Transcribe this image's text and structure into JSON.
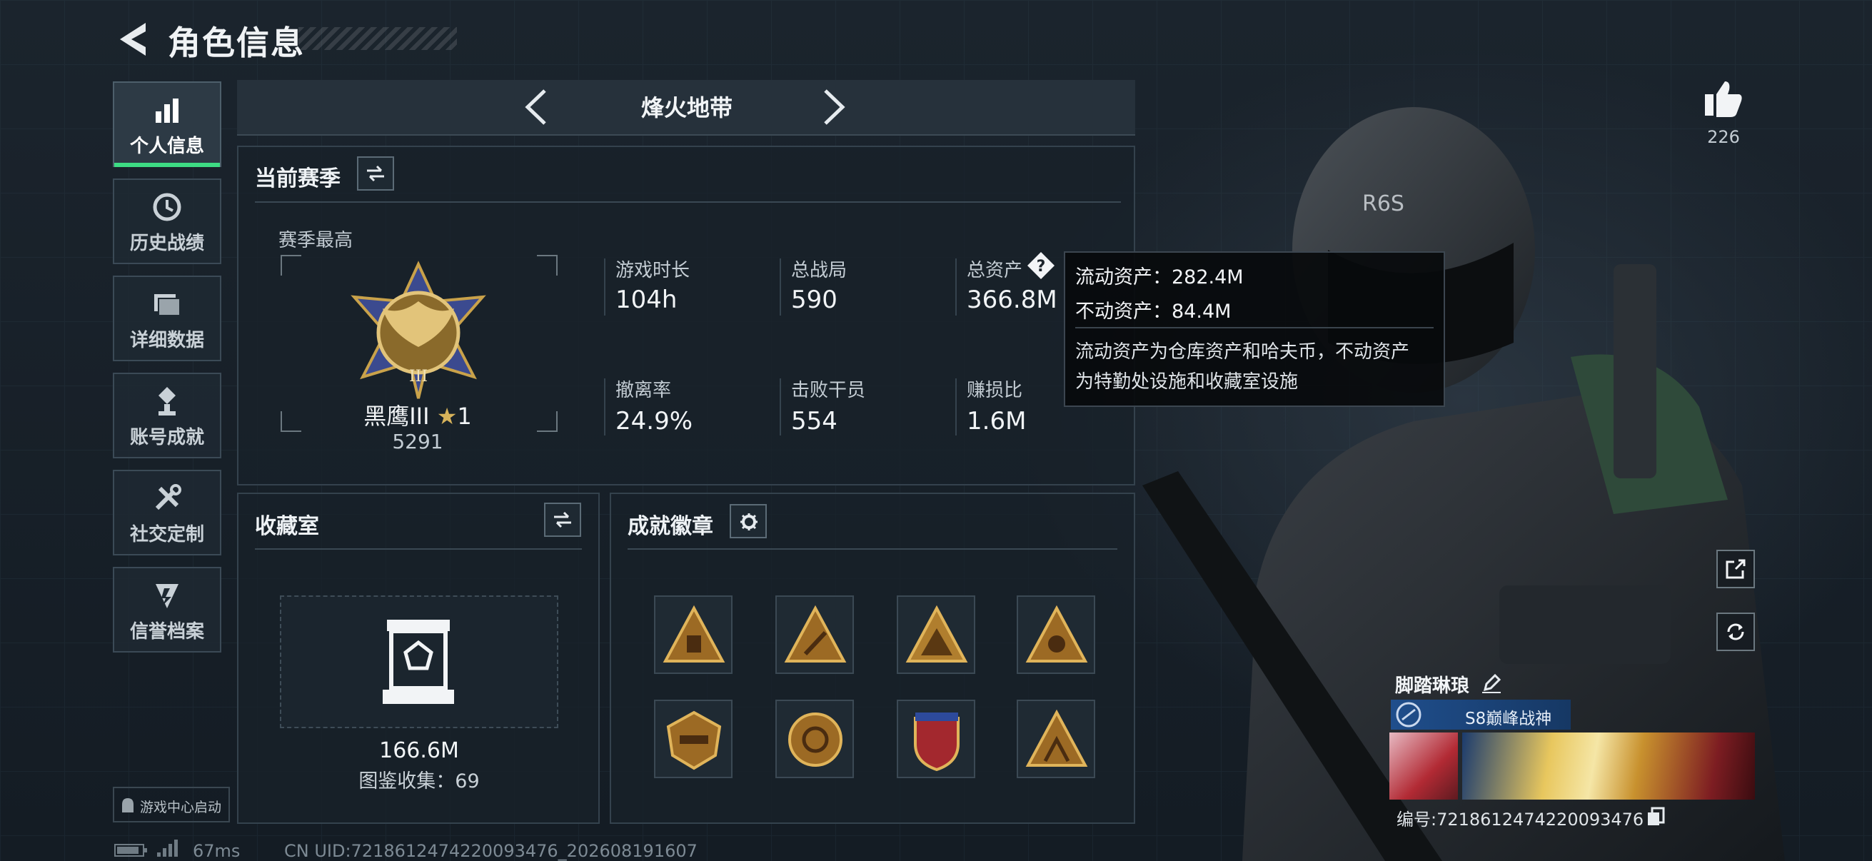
{
  "header": {
    "title": "角色信息"
  },
  "sidebar": {
    "items": [
      {
        "label": "个人信息",
        "icon": "bar-chart-icon",
        "active": true
      },
      {
        "label": "历史战绩",
        "icon": "history-icon"
      },
      {
        "label": "详细数据",
        "icon": "folders-icon"
      },
      {
        "label": "账号成就",
        "icon": "achievement-icon"
      },
      {
        "label": "社交定制",
        "icon": "tools-icon"
      },
      {
        "label": "信誉档案",
        "icon": "reputation-icon"
      }
    ],
    "game_center": "游戏中心启动"
  },
  "mode_selector": {
    "label": "烽火地带"
  },
  "season": {
    "title": "当前赛季",
    "best_label": "赛季最高",
    "rank_name": "黑鹰III",
    "rank_stars": "1",
    "rank_points": "5291",
    "stats": [
      {
        "label": "游戏时长",
        "value": "104h"
      },
      {
        "label": "总战局",
        "value": "590"
      },
      {
        "label": "总资产",
        "value": "366.8M",
        "has_help": true
      },
      {
        "label": "撤离率",
        "value": "24.9%"
      },
      {
        "label": "击败干员",
        "value": "554"
      },
      {
        "label": "赚损比",
        "value": "1.6M"
      }
    ]
  },
  "tooltip": {
    "liquid": "流动资产：282.4M",
    "fixed": "不动资产：84.4M",
    "desc1": "流动资产为仓库资产和哈夫币，不动资产",
    "desc2": "为特勤处设施和收藏室设施"
  },
  "collection": {
    "title": "收藏室",
    "value": "166.6M",
    "catalog": "图鉴收集：69"
  },
  "achievements": {
    "title": "成就徽章",
    "badges": [
      "badge-1",
      "badge-2",
      "badge-3",
      "badge-4",
      "badge-5",
      "badge-6",
      "badge-7",
      "badge-8"
    ]
  },
  "profile": {
    "likes": "226",
    "player_name": "脚踏琳琅",
    "title_badge": "S8巅峰战神",
    "id_label": "编号:7218612474220093476"
  },
  "status_bar": {
    "ping": "67ms",
    "uid": "CN UID:7218612474220093476_202608191607"
  },
  "colors": {
    "accent_green": "#3ddc84",
    "gold": "#c9a24a",
    "panel": "#18212a"
  }
}
